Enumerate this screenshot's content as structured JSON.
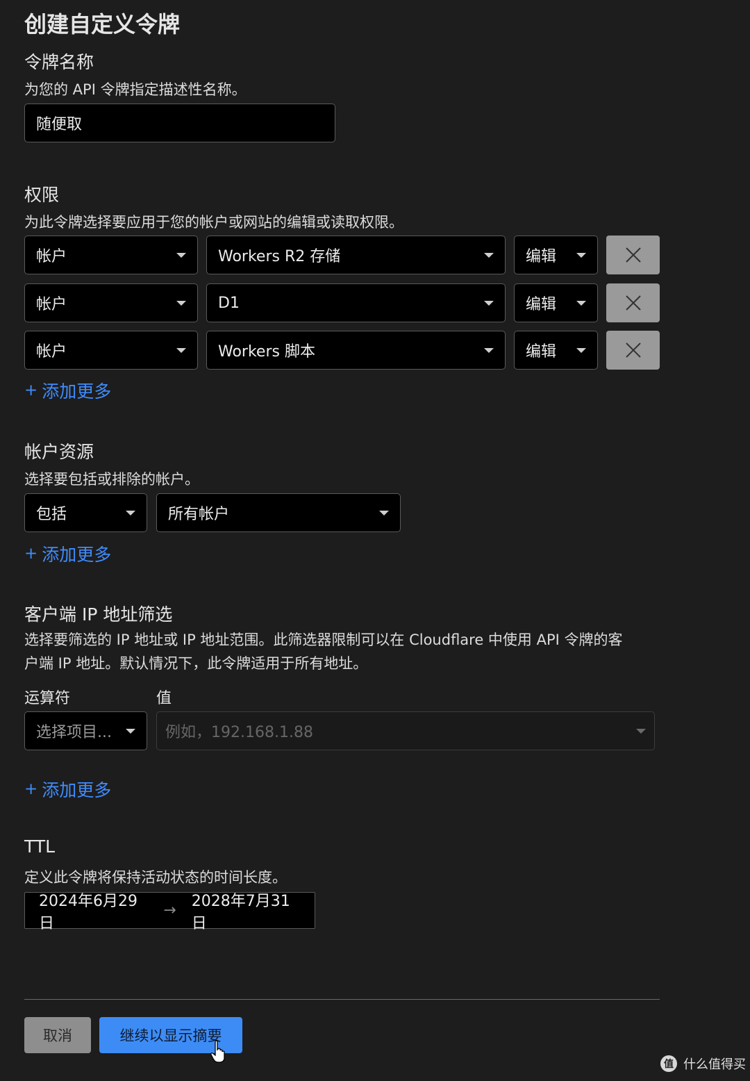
{
  "page_title": "创建自定义令牌",
  "token_name": {
    "heading": "令牌名称",
    "description": "为您的 API 令牌指定描述性名称。",
    "value": "随便取"
  },
  "permissions": {
    "heading": "权限",
    "description": "为此令牌选择要应用于您的帐户或网站的编辑或读取权限。",
    "rows": [
      {
        "scope": "帐户",
        "resource": "Workers R2 存储",
        "level": "编辑"
      },
      {
        "scope": "帐户",
        "resource": "D1",
        "level": "编辑"
      },
      {
        "scope": "帐户",
        "resource": "Workers 脚本",
        "level": "编辑"
      }
    ],
    "add_more": "添加更多"
  },
  "account_resources": {
    "heading": "帐户资源",
    "description": "选择要包括或排除的帐户。",
    "include": "包括",
    "account": "所有帐户",
    "add_more": "添加更多"
  },
  "ip_filter": {
    "heading": "客户端 IP 地址筛选",
    "description_line1": "选择要筛选的 IP 地址或 IP 地址范围。此筛选器限制可以在 Cloudflare 中使用 API 令牌的客",
    "description_line2": "户端 IP 地址。默认情况下，此令牌适用于所有地址。",
    "operator_label": "运算符",
    "value_label": "值",
    "operator_placeholder": "选择项目...",
    "value_placeholder": "例如，192.168.1.88",
    "add_more": "添加更多"
  },
  "ttl": {
    "heading": "TTL",
    "description": "定义此令牌将保持活动状态的时间长度。",
    "start": "2024年6月29日",
    "arrow": "→",
    "end": "2028年7月31日"
  },
  "actions": {
    "cancel": "取消",
    "continue": "继续以显示摘要"
  },
  "watermark": "什么值得买",
  "colors": {
    "background": "#1d1d1d",
    "link": "#3f8cff",
    "primary_button": "#3d8cf6",
    "secondary_button": "#8e8e8e"
  }
}
